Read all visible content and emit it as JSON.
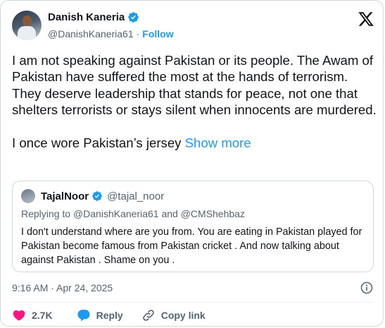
{
  "author": {
    "name": "Danish Kaneria",
    "handle": "@DanishKaneria61",
    "separator": "·",
    "follow_label": "Follow"
  },
  "tweet": {
    "paragraph1": "I am not speaking against Pakistan or its people. The Awam of Pakistan have suffered the most at the hands of terrorism. They deserve leadership that stands for peace, not one that shelters terrorists or stays silent when innocents are murdered.",
    "paragraph2": "I once wore Pakistan’s jersey",
    "show_more": "Show more"
  },
  "quote": {
    "name": "TajalNoor",
    "handle": "@tajal_noor",
    "replying_prefix": "Replying to",
    "replying_user1": "@DanishKaneria61",
    "replying_and": "and",
    "replying_user2": "@CMShehbaz",
    "text": "I don't understand where are you from.  You are eating in Pakistan played for Pakistan become famous from Pakistan cricket . And now talking about against Pakistan . Shame on you ."
  },
  "timestamp": "9:16 AM · Apr 24, 2025",
  "actions": {
    "like_count": "2.7K",
    "reply_label": "Reply",
    "copy_label": "Copy link"
  },
  "colors": {
    "accent": "#1d9bf0",
    "like": "#f91880",
    "text": "#0f1419",
    "muted": "#536471",
    "border": "#cfd9de"
  },
  "icons": [
    "verified-badge-icon",
    "x-logo-icon",
    "info-icon",
    "heart-icon",
    "reply-bubble-icon",
    "link-icon"
  ]
}
